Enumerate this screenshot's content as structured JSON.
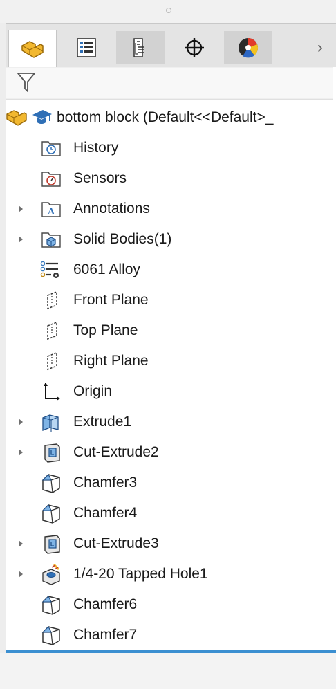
{
  "tabs": [
    {
      "icon": "part-icon",
      "active": true
    },
    {
      "icon": "property-manager-icon"
    },
    {
      "icon": "configuration-manager-icon",
      "shaded": true
    },
    {
      "icon": "dimxpert-icon"
    },
    {
      "icon": "display-manager-icon",
      "shaded": true
    }
  ],
  "tabs_more": "›",
  "filter": {
    "icon": "filter-icon",
    "value": ""
  },
  "tree": {
    "root_label": "bottom block  (Default<<Default>_",
    "items": [
      {
        "label": "History",
        "icon": "history-folder-icon",
        "expandable": false
      },
      {
        "label": "Sensors",
        "icon": "sensors-folder-icon",
        "expandable": false
      },
      {
        "label": "Annotations",
        "icon": "annotations-folder-icon",
        "expandable": true
      },
      {
        "label": "Solid Bodies(1)",
        "icon": "solid-bodies-folder-icon",
        "expandable": true
      },
      {
        "label": "6061 Alloy",
        "icon": "material-icon",
        "expandable": false
      },
      {
        "label": "Front Plane",
        "icon": "plane-icon",
        "expandable": false
      },
      {
        "label": "Top Plane",
        "icon": "plane-icon",
        "expandable": false
      },
      {
        "label": "Right Plane",
        "icon": "plane-icon",
        "expandable": false
      },
      {
        "label": "Origin",
        "icon": "origin-icon",
        "expandable": false
      },
      {
        "label": "Extrude1",
        "icon": "extrude-icon",
        "expandable": true
      },
      {
        "label": "Cut-Extrude2",
        "icon": "cut-extrude-icon",
        "expandable": true
      },
      {
        "label": "Chamfer3",
        "icon": "chamfer-icon",
        "expandable": false
      },
      {
        "label": "Chamfer4",
        "icon": "chamfer-icon",
        "expandable": false
      },
      {
        "label": "Cut-Extrude3",
        "icon": "cut-extrude-icon",
        "expandable": true
      },
      {
        "label": "1/4-20 Tapped Hole1",
        "icon": "hole-wizard-icon",
        "expandable": true
      },
      {
        "label": "Chamfer6",
        "icon": "chamfer-icon",
        "expandable": false
      },
      {
        "label": "Chamfer7",
        "icon": "chamfer-icon",
        "expandable": false
      }
    ]
  },
  "colors": {
    "accent_line": "#3b8fd1",
    "part_yellow": "#f2b830",
    "folder_blue": "#2f6fb6"
  }
}
